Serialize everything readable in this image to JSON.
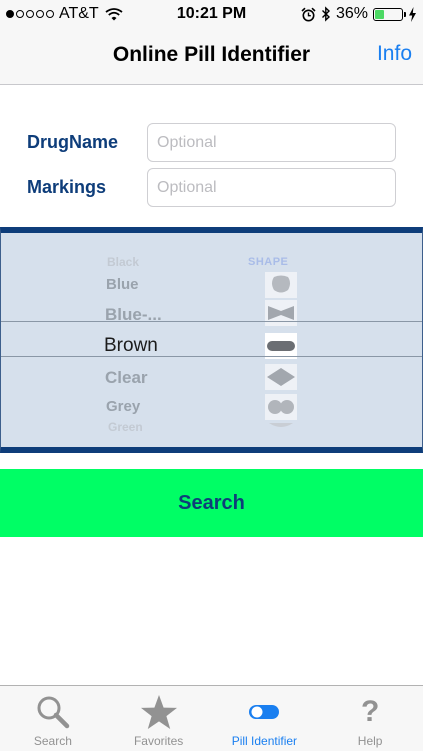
{
  "status_bar": {
    "carrier": "AT&T",
    "time": "10:21 PM",
    "battery": "36%",
    "battery_level": 0.36,
    "signal_bars_filled": 1,
    "signal_bars_total": 5,
    "icons": [
      "wifi-icon",
      "alarm-icon",
      "bluetooth-icon",
      "battery-icon",
      "charging-icon"
    ]
  },
  "nav": {
    "title": "Online Pill Identifier",
    "info_label": "Info"
  },
  "form": {
    "drug_name_label": "DrugName",
    "drug_name_placeholder": "Optional",
    "drug_name_value": "",
    "markings_label": "Markings",
    "markings_placeholder": "Optional",
    "markings_value": ""
  },
  "picker": {
    "shape_header": "SHAPE",
    "color_options": [
      "Black",
      "Blue",
      "Blue-...",
      "Brown",
      "Clear",
      "Grey",
      "Green"
    ],
    "selected_color": "Brown",
    "shape_icons": [
      "round-shape-icon",
      "bowtie-shape-icon",
      "capsule-shape-icon",
      "diamond-shape-icon",
      "figure-eight-shape-icon"
    ]
  },
  "search_button": {
    "label": "Search"
  },
  "tabs": [
    {
      "label": "Search",
      "icon": "magnifier-icon",
      "active": false
    },
    {
      "label": "Favorites",
      "icon": "star-icon",
      "active": false
    },
    {
      "label": "Pill Identifier",
      "icon": "pill-toggle-icon",
      "active": true
    },
    {
      "label": "Help",
      "icon": "question-icon",
      "active": false
    }
  ],
  "colors": {
    "accent_blue": "#1a7ff0",
    "label_navy": "#0e3d7a",
    "search_green": "#00fe65",
    "picker_bg": "#d6e0ec"
  }
}
